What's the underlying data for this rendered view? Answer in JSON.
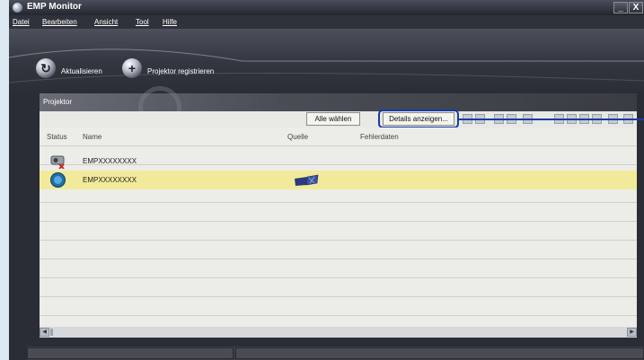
{
  "window": {
    "title": "EMP Monitor",
    "minimize_glyph": "_",
    "close_glyph": "X"
  },
  "menu": [
    "Datei",
    "Bearbeiten",
    "Ansicht",
    "Tool",
    "Hilfe"
  ],
  "toolbar": {
    "refresh_label": "Aktualisieren",
    "register_label": "Projektor registrieren"
  },
  "panel": {
    "title": "Projektor",
    "select_all": "Alle wählen",
    "details": "Details anzeigen..."
  },
  "columns": [
    "Status",
    "Name",
    "Quelle",
    "Fehlerdaten"
  ],
  "rows": [
    {
      "status_icon": "projector-error-icon",
      "name": "EMPXXXXXXXX",
      "source_icon": "",
      "error": "",
      "selected": false
    },
    {
      "status_icon": "power-on-icon",
      "name": "EMPXXXXXXXX",
      "source_icon": "source-video-icon",
      "error": "",
      "selected": true
    }
  ],
  "colors": {
    "selected_row": "#f2ea9a",
    "callout": "#1a3ba8",
    "chrome_dark": "#2a2d36"
  }
}
